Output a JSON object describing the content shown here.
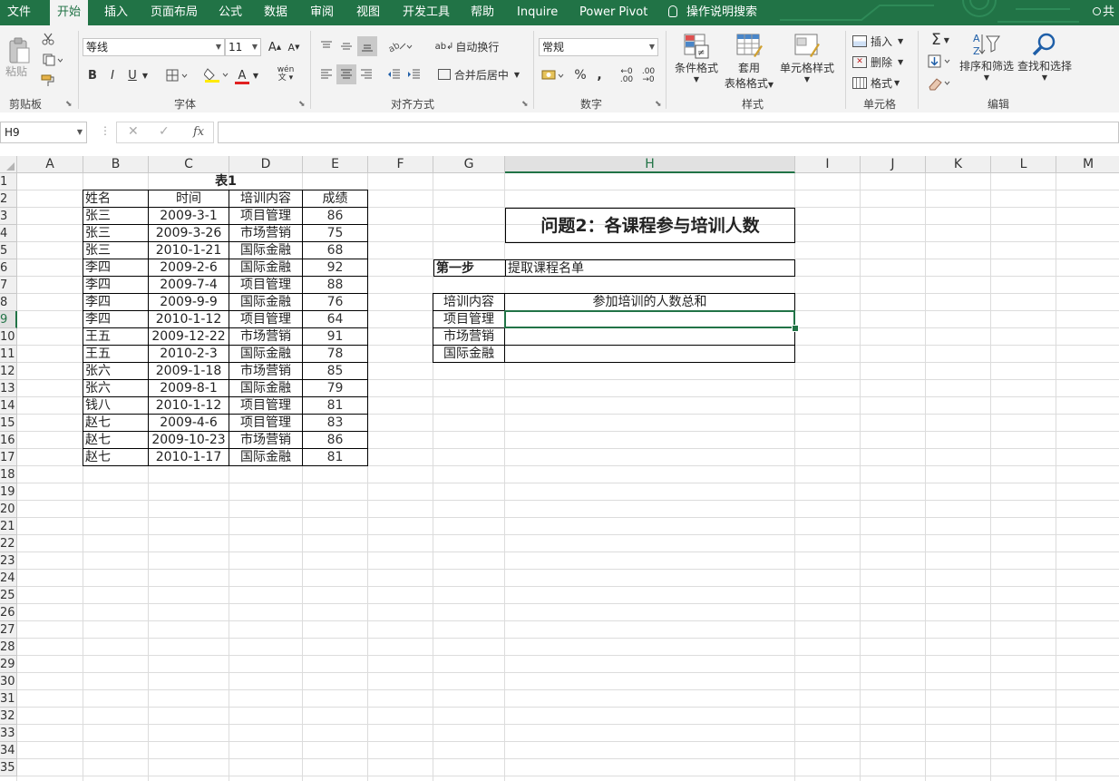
{
  "menu": {
    "tabs": [
      "文件",
      "开始",
      "插入",
      "页面布局",
      "公式",
      "数据",
      "审阅",
      "视图",
      "开发工具",
      "帮助",
      "Inquire",
      "Power Pivot"
    ],
    "search": "操作说明搜索",
    "share": "共"
  },
  "ribbon": {
    "clipboard": {
      "paste": "粘贴",
      "group": "剪贴板"
    },
    "font": {
      "name": "等线",
      "size": "11",
      "bold": "B",
      "italic": "I",
      "underline": "U",
      "font_color": "A",
      "phonetic": "wén",
      "group": "字体"
    },
    "alignment": {
      "wrap": "自动换行",
      "merge": "合并后居中",
      "group": "对齐方式"
    },
    "number": {
      "format": "常规",
      "percent": "%",
      "comma": ",",
      "inc_dec": ".00",
      "dec_dec": ".00",
      "group": "数字"
    },
    "styles": {
      "conditional": "条件格式",
      "table_a": "套用",
      "table_b": "表格格式",
      "cell_styles": "单元格样式",
      "group": "样式"
    },
    "cells": {
      "insert": "插入",
      "delete": "删除",
      "format": "格式",
      "group": "单元格"
    },
    "editing": {
      "sort": "排序和筛选",
      "find": "查找和选择",
      "group": "编辑"
    }
  },
  "formula_bar": {
    "name_box": "H9",
    "fx": "fx",
    "formula": ""
  },
  "sheet": {
    "columns": [
      "A",
      "B",
      "C",
      "D",
      "E",
      "F",
      "G",
      "H",
      "I",
      "J",
      "K",
      "L",
      "M"
    ],
    "rows": [
      "1",
      "2",
      "3",
      "4",
      "5",
      "6",
      "7",
      "8",
      "9",
      "10",
      "11",
      "12",
      "13",
      "14",
      "15",
      "16",
      "17",
      "18",
      "19",
      "20",
      "21",
      "22",
      "23",
      "24",
      "25",
      "26",
      "27",
      "28",
      "29",
      "30",
      "31",
      "32",
      "33",
      "34",
      "35"
    ],
    "table1": {
      "title": "表1",
      "headers": [
        "姓名",
        "时间",
        "培训内容",
        "成绩"
      ],
      "rows": [
        [
          "张三",
          "2009-3-1",
          "项目管理",
          "86"
        ],
        [
          "张三",
          "2009-3-26",
          "市场营销",
          "75"
        ],
        [
          "张三",
          "2010-1-21",
          "国际金融",
          "68"
        ],
        [
          "李四",
          "2009-2-6",
          "国际金融",
          "92"
        ],
        [
          "李四",
          "2009-7-4",
          "项目管理",
          "88"
        ],
        [
          "李四",
          "2009-9-9",
          "国际金融",
          "76"
        ],
        [
          "李四",
          "2010-1-12",
          "项目管理",
          "64"
        ],
        [
          "王五",
          "2009-12-22",
          "市场营销",
          "91"
        ],
        [
          "王五",
          "2010-2-3",
          "国际金融",
          "78"
        ],
        [
          "张六",
          "2009-1-18",
          "市场营销",
          "85"
        ],
        [
          "张六",
          "2009-8-1",
          "国际金融",
          "79"
        ],
        [
          "钱八",
          "2010-1-12",
          "项目管理",
          "81"
        ],
        [
          "赵七",
          "2009-4-6",
          "项目管理",
          "83"
        ],
        [
          "赵七",
          "2009-10-23",
          "市场营销",
          "86"
        ],
        [
          "赵七",
          "2010-1-17",
          "国际金融",
          "81"
        ]
      ]
    },
    "question": {
      "title": "问题2：各课程参与培训人数",
      "step_label": "第一步",
      "step_text": "提取课程名单",
      "headers": [
        "培训内容",
        "参加培训的人数总和"
      ],
      "rows": [
        [
          "项目管理",
          ""
        ],
        [
          "市场营销",
          ""
        ],
        [
          "国际金融",
          ""
        ]
      ]
    }
  }
}
